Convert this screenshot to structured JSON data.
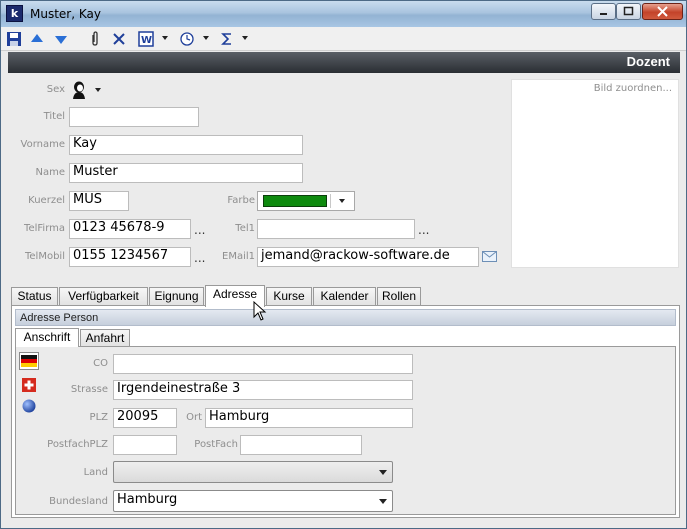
{
  "window": {
    "title": "Muster, Kay"
  },
  "header": {
    "title": "Dozent"
  },
  "photo": {
    "label": "Bild zuordnen..."
  },
  "form": {
    "sex_label": "Sex",
    "titel_label": "Titel",
    "titel_value": "",
    "vorname_label": "Vorname",
    "vorname_value": "Kay",
    "name_label": "Name",
    "name_value": "Muster",
    "kuerzel_label": "Kuerzel",
    "kuerzel_value": "MUS",
    "farbe_label": "Farbe",
    "farbe_color": "#0e8a0e",
    "telfirma_label": "TelFirma",
    "telfirma_value": "0123 45678-9",
    "tel1_label": "Tel1",
    "tel1_value": "",
    "telmobil_label": "TelMobil",
    "telmobil_value": "0155 1234567",
    "email_label": "EMail1",
    "email_value": "jemand@rackow-software.de",
    "dots": "..."
  },
  "tabs": [
    {
      "label": "Status"
    },
    {
      "label": "Verfügbarkeit"
    },
    {
      "label": "Eignung"
    },
    {
      "label": "Adresse"
    },
    {
      "label": "Kurse"
    },
    {
      "label": "Kalender"
    },
    {
      "label": "Rollen"
    }
  ],
  "address": {
    "section_title": "Adresse Person",
    "subtabs": [
      {
        "label": "Anschrift"
      },
      {
        "label": "Anfahrt"
      }
    ],
    "co_label": "CO",
    "co_value": "",
    "strasse_label": "Strasse",
    "strasse_value": "Irgendeinestraße 3",
    "plz_label": "PLZ",
    "plz_value": "20095",
    "ort_label": "Ort",
    "ort_value": "Hamburg",
    "postfachplz_label": "PostfachPLZ",
    "postfachplz_value": "",
    "postfach_label": "PostFach",
    "postfach_value": "",
    "land_label": "Land",
    "land_value": "",
    "bundesland_label": "Bundesland",
    "bundesland_value": "Hamburg"
  }
}
